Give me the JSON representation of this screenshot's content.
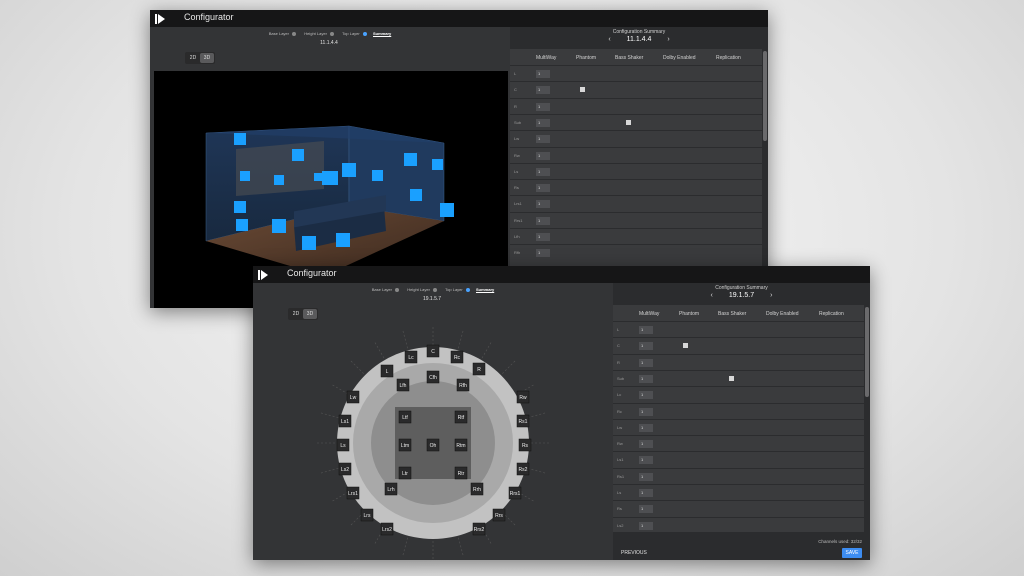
{
  "window1": {
    "title": "Configurator",
    "layers": [
      "Base Layer",
      "Height Layer",
      "Top Layer",
      "Summary"
    ],
    "config_id": "11.1.4.4",
    "view_toggle": [
      "2D",
      "3D"
    ],
    "active_view": "3D",
    "summary": {
      "title": "Configuration Summary",
      "config_id": "11.1.4.4",
      "columns": [
        "MultiWay",
        "Phantom",
        "Bass Shaker",
        "Dolby Enabled",
        "Replication"
      ],
      "rows": [
        {
          "label": "L",
          "value": "1",
          "phantom": false,
          "bass": false
        },
        {
          "label": "C",
          "value": "1",
          "phantom": true,
          "bass": false
        },
        {
          "label": "R",
          "value": "1",
          "phantom": false,
          "bass": false
        },
        {
          "label": "Sub",
          "value": "1",
          "phantom": false,
          "bass": true
        },
        {
          "label": "Lw",
          "value": "1",
          "phantom": false,
          "bass": false
        },
        {
          "label": "Rw",
          "value": "1",
          "phantom": false,
          "bass": false
        },
        {
          "label": "Ls",
          "value": "1",
          "phantom": false,
          "bass": false
        },
        {
          "label": "Rs",
          "value": "1",
          "phantom": false,
          "bass": false
        },
        {
          "label": "Lrs1",
          "value": "1",
          "phantom": false,
          "bass": false
        },
        {
          "label": "Rrs1",
          "value": "1",
          "phantom": false,
          "bass": false
        },
        {
          "label": "Lfh",
          "value": "1",
          "phantom": false,
          "bass": false
        },
        {
          "label": "Rfh",
          "value": "1",
          "phantom": false,
          "bass": false
        }
      ]
    }
  },
  "window2": {
    "title": "Configurator",
    "layers": [
      "Base Layer",
      "Height Layer",
      "Top Layer",
      "Summary"
    ],
    "config_id": "19.1.5.7",
    "view_toggle": [
      "2D",
      "3D"
    ],
    "active_view": "3D",
    "speakers": {
      "outer": [
        "L",
        "Lc",
        "C",
        "Rc",
        "R",
        "Lw",
        "Rw",
        "Ls1",
        "Rs1",
        "Ls",
        "Rs",
        "Ls2",
        "Rs2",
        "Lrs1",
        "Rrs1",
        "Lrs",
        "Rrs",
        "Lrs2",
        "Rrs2"
      ],
      "middle": [
        "Lfh",
        "Cfh",
        "Rfh",
        "Lrh",
        "Rrh"
      ],
      "inner": [
        "Ltf",
        "Rtf",
        "Ltm",
        "Oh",
        "Rtm",
        "Ltr",
        "Rtr"
      ]
    },
    "summary": {
      "title": "Configuration Summary",
      "config_id": "19.1.5.7",
      "columns": [
        "MultiWay",
        "Phantom",
        "Bass Shaker",
        "Dolby Enabled",
        "Replication"
      ],
      "rows": [
        {
          "label": "L",
          "value": "1",
          "phantom": false,
          "bass": false
        },
        {
          "label": "C",
          "value": "1",
          "phantom": true,
          "bass": false
        },
        {
          "label": "R",
          "value": "1",
          "phantom": false,
          "bass": false
        },
        {
          "label": "Sub",
          "value": "1",
          "phantom": false,
          "bass": true
        },
        {
          "label": "Lc",
          "value": "1",
          "phantom": false,
          "bass": false
        },
        {
          "label": "Rc",
          "value": "1",
          "phantom": false,
          "bass": false
        },
        {
          "label": "Lw",
          "value": "1",
          "phantom": false,
          "bass": false
        },
        {
          "label": "Rw",
          "value": "1",
          "phantom": false,
          "bass": false
        },
        {
          "label": "Ls1",
          "value": "1",
          "phantom": false,
          "bass": false
        },
        {
          "label": "Rs1",
          "value": "1",
          "phantom": false,
          "bass": false
        },
        {
          "label": "Ls",
          "value": "1",
          "phantom": false,
          "bass": false
        },
        {
          "label": "Rs",
          "value": "1",
          "phantom": false,
          "bass": false
        },
        {
          "label": "Ls2",
          "value": "1",
          "phantom": false,
          "bass": false
        }
      ]
    },
    "channels_used_label": "Channels used:",
    "channels_used_value": "32/32",
    "previous_label": "PREVIOUS",
    "save_label": "SAVE"
  },
  "colors": {
    "accent": "#3d8df2",
    "speaker_blue": "#1aa0ff"
  }
}
